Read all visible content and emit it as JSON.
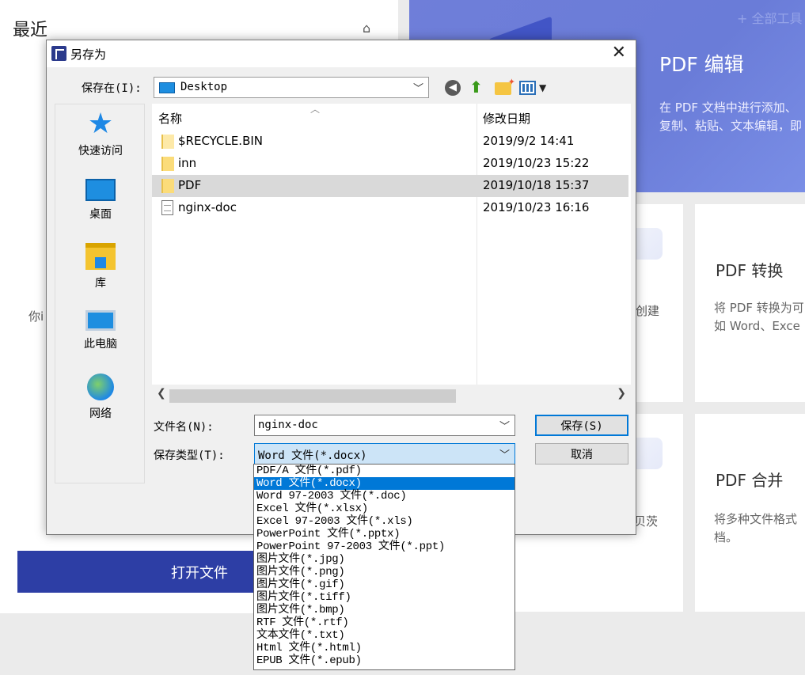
{
  "background_app": {
    "recent_title": "最近",
    "hint_text": "你i",
    "open_file_label": "打开文件",
    "faint_label": "+ 全部工具",
    "pdf_edit": {
      "title": "PDF 编辑",
      "desc": "在 PDF 文档中进行添加、\n复制、粘贴、文本编辑，即"
    },
    "create_fragment": "创建",
    "copy_fragment": "贝茨",
    "pdf_convert": {
      "title": "PDF 转换",
      "desc": "将 PDF 转换为可\n如 Word、Exce"
    },
    "pdf_merge": {
      "title": "PDF 合并",
      "desc": "将多种文件格式\n档。"
    }
  },
  "dialog": {
    "title": "另存为",
    "save_in_label": "保存在(I):",
    "location": "Desktop",
    "places": [
      "快速访问",
      "桌面",
      "库",
      "此电脑",
      "网络"
    ],
    "columns": {
      "name": "名称",
      "modified": "修改日期"
    },
    "files": [
      {
        "name": "$RECYCLE.BIN",
        "date": "2019/9/2 14:41",
        "type": "folder-light"
      },
      {
        "name": "inn",
        "date": "2019/10/23 15:22",
        "type": "folder"
      },
      {
        "name": "PDF",
        "date": "2019/10/18 15:37",
        "type": "folder",
        "selected": true
      },
      {
        "name": "nginx-doc",
        "date": "2019/10/23 16:16",
        "type": "document"
      }
    ],
    "filename_label": "文件名(N):",
    "filename_value": "nginx-doc",
    "filetype_label": "保存类型(T):",
    "filetype_value": "Word 文件(*.docx)",
    "save_button": "保存(S)",
    "cancel_button": "取消",
    "filetype_options": [
      "PDF/A 文件(*.pdf)",
      "Word 文件(*.docx)",
      "Word 97-2003 文件(*.doc)",
      "Excel 文件(*.xlsx)",
      "Excel 97-2003 文件(*.xls)",
      "PowerPoint 文件(*.pptx)",
      "PowerPoint 97-2003 文件(*.ppt)",
      "图片文件(*.jpg)",
      "图片文件(*.png)",
      "图片文件(*.gif)",
      "图片文件(*.tiff)",
      "图片文件(*.bmp)",
      "RTF 文件(*.rtf)",
      "文本文件(*.txt)",
      "Html 文件(*.html)",
      "EPUB 文件(*.epub)"
    ],
    "selected_option_index": 1
  },
  "colors": {
    "accent": "#0078d7",
    "brand": "#2d3ea5",
    "selection_row": "#d9d9d9"
  }
}
